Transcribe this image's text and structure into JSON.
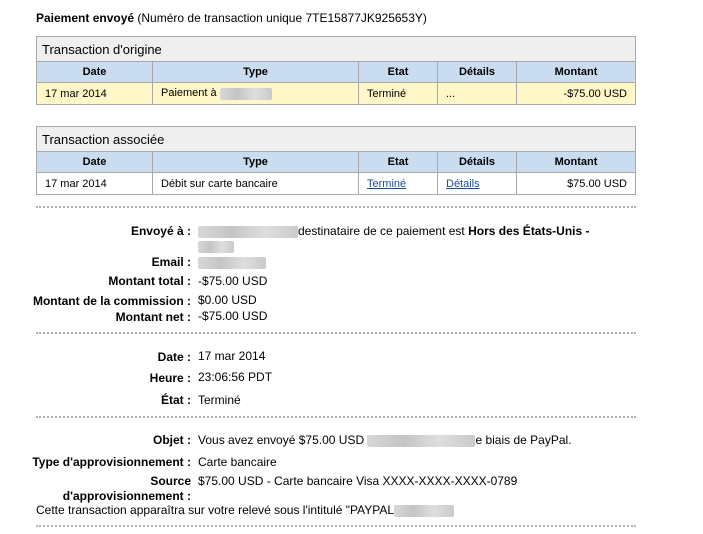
{
  "header": {
    "title": "Paiement envoyé",
    "transaction_id": "(Numéro de transaction unique 7TE15877JK925653Y)"
  },
  "original": {
    "caption": "Transaction d'origine",
    "columns": [
      "Date",
      "Type",
      "Etat",
      "Détails",
      "Montant"
    ],
    "row": {
      "date": "17 mar 2014",
      "type": "Paiement à",
      "status": "Terminé",
      "details": "...",
      "amount": "-$75.00 USD"
    }
  },
  "related": {
    "caption": "Transaction associée",
    "columns": [
      "Date",
      "Type",
      "Etat",
      "Détails",
      "Montant"
    ],
    "row": {
      "date": "17 mar 2014",
      "type": "Débit sur carte bancaire",
      "status": "Terminé",
      "details": "Détails",
      "amount": "$75.00 USD"
    }
  },
  "summary": {
    "sent_to_label": "Envoyé à :",
    "sent_to_text": "destinataire de ce paiement est",
    "sent_to_bold": "Hors des États-Unis",
    "sent_to_suffix": " -",
    "email_label": "Email :",
    "total_label": "Montant total :",
    "total_value": "-$75.00 USD",
    "fee_label": "Montant de la commission :",
    "fee_value": "$0.00 USD",
    "net_label": "Montant net :",
    "net_value": "-$75.00 USD"
  },
  "timing": {
    "date_label": "Date :",
    "date_value": "17 mar 2014",
    "time_label": "Heure :",
    "time_value": "23:06:56 PDT",
    "status_label": "État :",
    "status_value": "Terminé"
  },
  "funding": {
    "subject_label": "Objet :",
    "subject_value": "Vous avez envoyé $75.00 USD",
    "subject_suffix": "e biais de PayPal.",
    "type_label": "Type d'approvisionnement :",
    "type_value": "Carte bancaire",
    "source_label_1": "Source",
    "source_label_2": "d'approvisionnement :",
    "source_value": "$75.00 USD - Carte bancaire Visa XXXX-XXXX-XXXX-0789",
    "statement_note": "Cette transaction apparaîtra sur votre relevé sous l'intitulé \"PAYPAL"
  }
}
